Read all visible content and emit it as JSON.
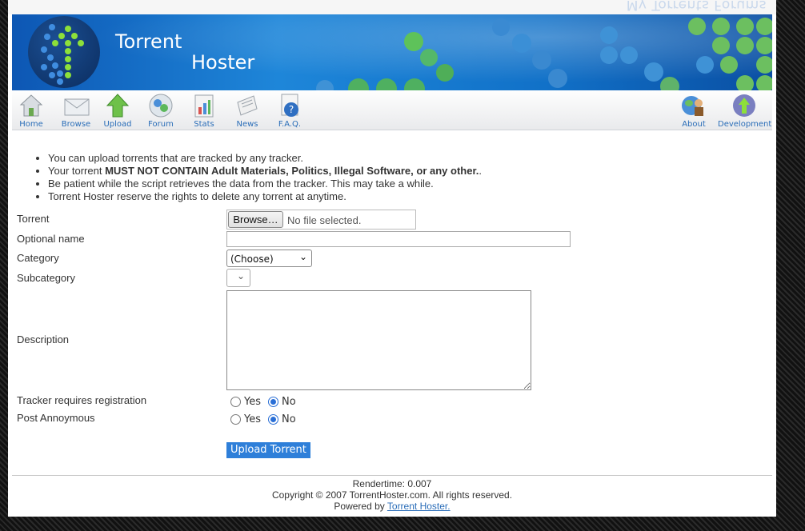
{
  "top_links": "My Torrents Forums",
  "brand": {
    "line1": "Torrent",
    "line2": "Hoster"
  },
  "nav": {
    "left": [
      {
        "label": "Home",
        "icon": "home-icon"
      },
      {
        "label": "Browse",
        "icon": "browse-icon"
      },
      {
        "label": "Upload",
        "icon": "upload-icon"
      },
      {
        "label": "Forum",
        "icon": "forum-icon"
      },
      {
        "label": "Stats",
        "icon": "stats-icon"
      },
      {
        "label": "News",
        "icon": "news-icon"
      },
      {
        "label": "F.A.Q.",
        "icon": "faq-icon"
      }
    ],
    "right": [
      {
        "label": "About",
        "icon": "about-icon"
      },
      {
        "label": "Development",
        "icon": "development-icon"
      }
    ]
  },
  "rules": {
    "r1": "You can upload torrents that are tracked by any tracker.",
    "r2_pre": "Your torrent ",
    "r2_bold": "MUST NOT CONTAIN Adult Materials, Politics, Illegal Software, or any other.",
    "r2_post": ".",
    "r3": "Be patient while the script retrieves the data from the tracker. This may take a while.",
    "r4": "Torrent Hoster reserve the rights to delete any torrent at anytime."
  },
  "form": {
    "torrent_label": "Torrent",
    "browse_label": "Browse…",
    "file_status": "No file selected.",
    "optional_name_label": "Optional name",
    "optional_name_value": "",
    "category_label": "Category",
    "category_selected": "(Choose)",
    "subcategory_label": "Subcategory",
    "subcategory_selected": "",
    "description_label": "Description",
    "description_value": "",
    "tracker_reg_label": "Tracker requires registration",
    "post_anon_label": "Post Annoymous",
    "yes": "Yes",
    "no": "No",
    "tracker_reg_value": "No",
    "post_anon_value": "No",
    "submit_label": "Upload Torrent"
  },
  "footer": {
    "rendertime": "Rendertime: 0.007",
    "copyright": "Copyright © 2007 TorrentHoster.com. All rights reserved.",
    "powered_pre": "Powered by ",
    "powered_link": "Torrent Hoster."
  },
  "colors": {
    "header_blue": "#1171c8",
    "link_blue": "#2a6db8",
    "button_blue": "#2e7fd9",
    "radio_blue": "#2a6fd6",
    "logo_green": "#8de03a"
  }
}
